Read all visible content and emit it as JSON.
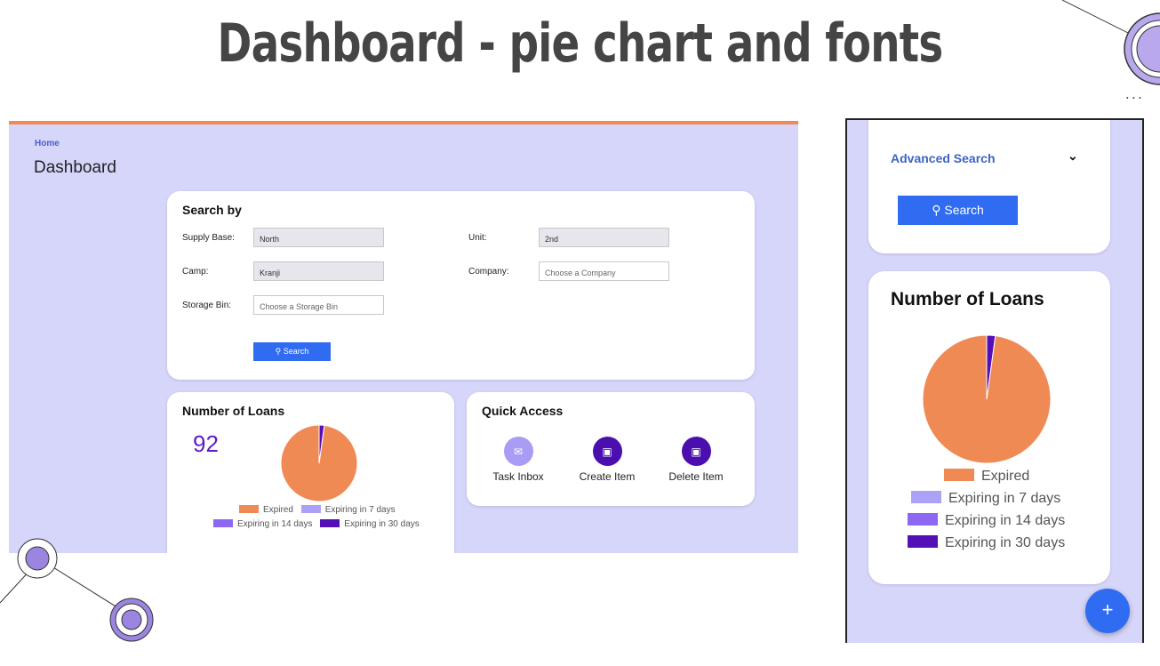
{
  "slide": {
    "title": "Dashboard - pie chart and fonts",
    "dots": "..."
  },
  "desktop": {
    "breadcrumb": "Home",
    "page_title": "Dashboard",
    "search": {
      "title": "Search by",
      "supply_base_label": "Supply Base:",
      "supply_base_value": "North",
      "unit_label": "Unit:",
      "unit_value": "2nd",
      "camp_label": "Camp:",
      "camp_value": "Kranji",
      "company_label": "Company:",
      "company_placeholder": "Choose a Company",
      "storage_bin_label": "Storage Bin:",
      "storage_bin_placeholder": "Choose a Storage Bin",
      "button_label": "Search"
    },
    "loans": {
      "title": "Number of Loans",
      "count": "92"
    },
    "quick_access": {
      "title": "Quick Access",
      "items": [
        {
          "label": "Task Inbox",
          "icon": "mail-icon",
          "color": "#a99cf5"
        },
        {
          "label": "Create Item",
          "icon": "folder-plus-icon",
          "color": "#4a0fae"
        },
        {
          "label": "Delete Item",
          "icon": "folder-minus-icon",
          "color": "#4a0fae"
        }
      ]
    }
  },
  "mobile": {
    "advanced_search": "Advanced Search",
    "button_label": "Search",
    "loans_title": "Number of Loans",
    "fab_label": "+"
  },
  "colors": {
    "expired": "#ef8a55",
    "expiring_7": "#aba1f7",
    "expiring_14": "#8b67f2",
    "expiring_30": "#5410b6",
    "primary": "#2f6cf2",
    "background": "#d6d5fa"
  },
  "chart_data": {
    "type": "pie",
    "title": "Number of Loans",
    "categories": [
      "Expired",
      "Expiring in 7 days",
      "Expiring in 14 days",
      "Expiring in 30 days"
    ],
    "values": [
      90,
      0,
      0,
      2
    ],
    "colors": [
      "#ef8a55",
      "#aba1f7",
      "#8b67f2",
      "#5410b6"
    ],
    "legend_position": "bottom"
  }
}
